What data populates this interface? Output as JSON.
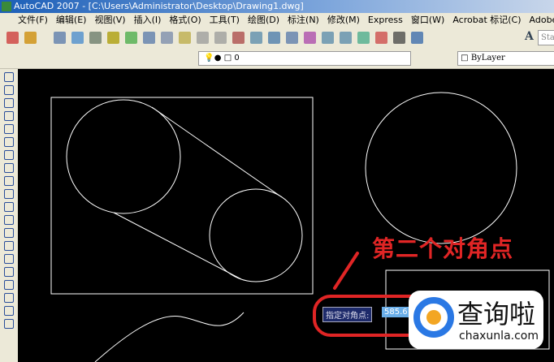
{
  "title": "AutoCAD 2007 - [C:\\Users\\Administrator\\Desktop\\Drawing1.dwg]",
  "menu": [
    "文件(F)",
    "编辑(E)",
    "视图(V)",
    "插入(I)",
    "格式(O)",
    "工具(T)",
    "绘图(D)",
    "标注(N)",
    "修改(M)",
    "Express",
    "窗口(W)",
    "Acrobat 标记(C)",
    "Adobe"
  ],
  "layer": {
    "name": "0"
  },
  "color": {
    "value": "ByLayer"
  },
  "style": {
    "value": "Sta"
  },
  "prompt": {
    "label": "指定对角点:",
    "value": "585.6"
  },
  "annotation": "第二个对角点",
  "watermark": {
    "cn": "查询啦",
    "en": "chaxunla.com"
  },
  "colors": {
    "annotation": "#e02525",
    "canvas": "#000000"
  }
}
